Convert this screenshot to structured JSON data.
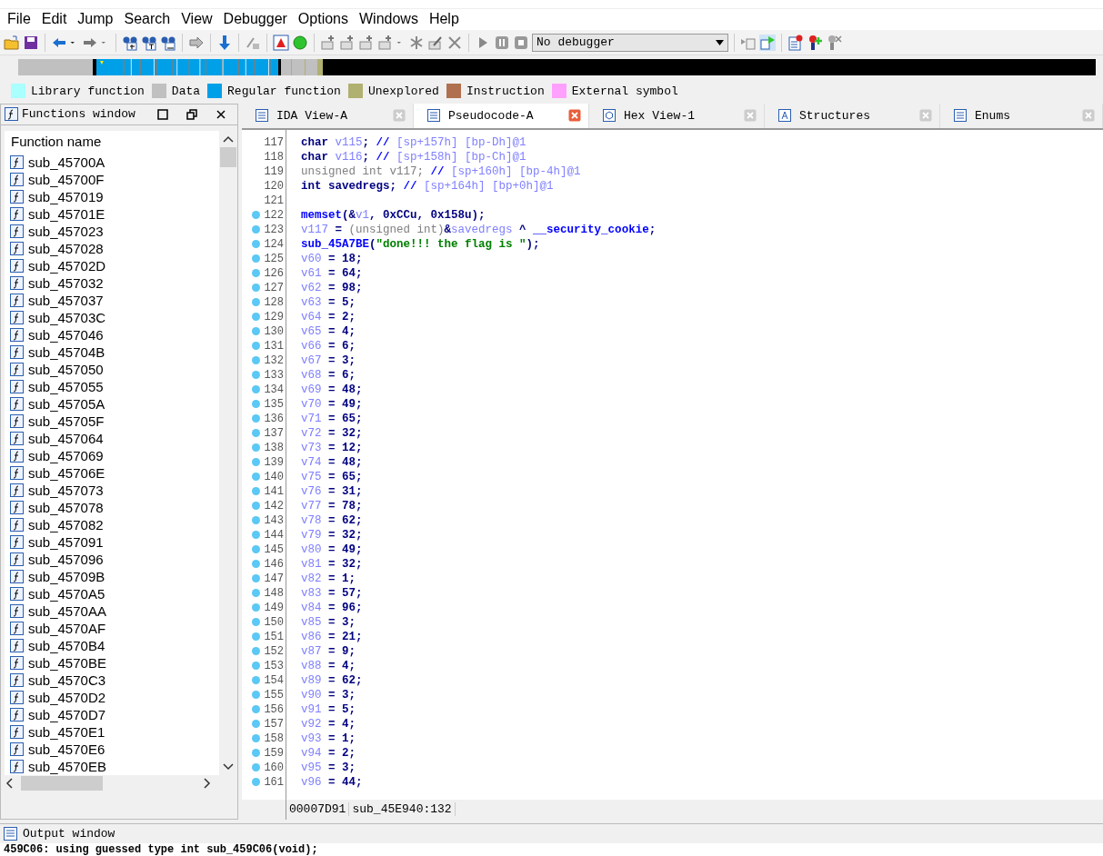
{
  "menu": [
    "File",
    "Edit",
    "Jump",
    "Search",
    "View",
    "Debugger",
    "Options",
    "Windows",
    "Help"
  ],
  "toolbar": {
    "debugger_select": "No debugger"
  },
  "legend": [
    {
      "label": "Library function",
      "color": "#aaffff"
    },
    {
      "label": "Data",
      "color": "#c0c0c0"
    },
    {
      "label": "Regular function",
      "color": "#00a0e8"
    },
    {
      "label": "Unexplored",
      "color": "#b0b070"
    },
    {
      "label": "Instruction",
      "color": "#b07050"
    },
    {
      "label": "External symbol",
      "color": "#ffa0ff"
    }
  ],
  "functions_window": {
    "title": "Functions window",
    "column": "Function name",
    "items": [
      "sub_45700A",
      "sub_45700F",
      "sub_457019",
      "sub_45701E",
      "sub_457023",
      "sub_457028",
      "sub_45702D",
      "sub_457032",
      "sub_457037",
      "sub_45703C",
      "sub_457046",
      "sub_45704B",
      "sub_457050",
      "sub_457055",
      "sub_45705A",
      "sub_45705F",
      "sub_457064",
      "sub_457069",
      "sub_45706E",
      "sub_457073",
      "sub_457078",
      "sub_457082",
      "sub_457091",
      "sub_457096",
      "sub_45709B",
      "sub_4570A5",
      "sub_4570AA",
      "sub_4570AF",
      "sub_4570B4",
      "sub_4570BE",
      "sub_4570C3",
      "sub_4570D2",
      "sub_4570D7",
      "sub_4570E1",
      "sub_4570E6",
      "sub_4570EB"
    ]
  },
  "tabs": [
    {
      "label": "IDA View-A",
      "kind": "listing",
      "selected": false
    },
    {
      "label": "Pseudocode-A",
      "kind": "listing",
      "selected": true
    },
    {
      "label": "Hex View-1",
      "kind": "hex",
      "selected": false
    },
    {
      "label": "Structures",
      "kind": "struct",
      "selected": false
    },
    {
      "label": "Enums",
      "kind": "listing",
      "selected": false
    }
  ],
  "code": [
    {
      "line": "117",
      "breakpoint": false,
      "parts": [
        {
          "text": "char",
          "kind": "keyword"
        },
        {
          "text": " v115",
          "kind": "variable"
        },
        {
          "text": "; ",
          "kind": "plain"
        },
        {
          "text": "// ",
          "kind": "slash"
        },
        {
          "text": "[sp+157h] [bp-Dh]@1",
          "kind": "comment"
        }
      ]
    },
    {
      "line": "118",
      "breakpoint": false,
      "parts": [
        {
          "text": "char",
          "kind": "keyword"
        },
        {
          "text": " v116",
          "kind": "variable"
        },
        {
          "text": "; ",
          "kind": "plain"
        },
        {
          "text": "// ",
          "kind": "slash"
        },
        {
          "text": "[sp+158h] [bp-Ch]@1",
          "kind": "comment"
        }
      ]
    },
    {
      "line": "119",
      "breakpoint": false,
      "parts": [
        {
          "text": "unsigned int v117; ",
          "kind": "unused"
        },
        {
          "text": "// ",
          "kind": "slash"
        },
        {
          "text": "[sp+160h] [bp-4h]@1",
          "kind": "comment"
        }
      ]
    },
    {
      "line": "120",
      "breakpoint": false,
      "parts": [
        {
          "text": "int",
          "kind": "keyword"
        },
        {
          "text": " savedregs; ",
          "kind": "plain"
        },
        {
          "text": "// ",
          "kind": "slash"
        },
        {
          "text": "[sp+164h] [bp+0h]@1",
          "kind": "comment"
        }
      ]
    },
    {
      "line": "121",
      "breakpoint": false
    },
    {
      "line": "122",
      "breakpoint": true,
      "parts": [
        {
          "text": "memset",
          "kind": "function"
        },
        {
          "text": "(&",
          "kind": "plain"
        },
        {
          "text": "v1",
          "kind": "variable"
        },
        {
          "text": ", 0xCCu, 0x158u);",
          "kind": "plain"
        }
      ]
    },
    {
      "line": "123",
      "breakpoint": true,
      "parts": [
        {
          "text": "v117",
          "kind": "variable"
        },
        {
          "text": " = ",
          "kind": "plain"
        },
        {
          "text": "(unsigned int)",
          "kind": "unused"
        },
        {
          "text": "&",
          "kind": "plain"
        },
        {
          "text": "savedregs",
          "kind": "variable"
        },
        {
          "text": " ^ ",
          "kind": "plain"
        },
        {
          "text": "__security_cookie",
          "kind": "function"
        },
        {
          "text": ";",
          "kind": "plain"
        }
      ]
    },
    {
      "line": "124",
      "breakpoint": true,
      "parts": [
        {
          "text": "sub_45A7BE",
          "kind": "function"
        },
        {
          "text": "(",
          "kind": "plain"
        },
        {
          "text": "\"done!!! the flag is \"",
          "kind": "string"
        },
        {
          "text": ");",
          "kind": "plain"
        }
      ]
    },
    {
      "line": "125",
      "breakpoint": true,
      "parts": [
        {
          "text": "v60",
          "kind": "variable"
        },
        {
          "text": " = 18;",
          "kind": "plain"
        }
      ]
    },
    {
      "line": "126",
      "breakpoint": true,
      "parts": [
        {
          "text": "v61",
          "kind": "variable"
        },
        {
          "text": " = 64;",
          "kind": "plain"
        }
      ]
    },
    {
      "line": "127",
      "breakpoint": true,
      "parts": [
        {
          "text": "v62",
          "kind": "variable"
        },
        {
          "text": " = 98;",
          "kind": "plain"
        }
      ]
    },
    {
      "line": "128",
      "breakpoint": true,
      "parts": [
        {
          "text": "v63",
          "kind": "variable"
        },
        {
          "text": " = 5;",
          "kind": "plain"
        }
      ]
    },
    {
      "line": "129",
      "breakpoint": true,
      "parts": [
        {
          "text": "v64",
          "kind": "variable"
        },
        {
          "text": " = 2;",
          "kind": "plain"
        }
      ]
    },
    {
      "line": "130",
      "breakpoint": true,
      "parts": [
        {
          "text": "v65",
          "kind": "variable"
        },
        {
          "text": " = 4;",
          "kind": "plain"
        }
      ]
    },
    {
      "line": "131",
      "breakpoint": true,
      "parts": [
        {
          "text": "v66",
          "kind": "variable"
        },
        {
          "text": " = 6;",
          "kind": "plain"
        }
      ]
    },
    {
      "line": "132",
      "breakpoint": true,
      "parts": [
        {
          "text": "v67",
          "kind": "variable"
        },
        {
          "text": " = 3;",
          "kind": "plain"
        }
      ]
    },
    {
      "line": "133",
      "breakpoint": true,
      "parts": [
        {
          "text": "v68",
          "kind": "variable"
        },
        {
          "text": " = 6;",
          "kind": "plain"
        }
      ]
    },
    {
      "line": "134",
      "breakpoint": true,
      "parts": [
        {
          "text": "v69",
          "kind": "variable"
        },
        {
          "text": " = 48;",
          "kind": "plain"
        }
      ]
    },
    {
      "line": "135",
      "breakpoint": true,
      "parts": [
        {
          "text": "v70",
          "kind": "variable"
        },
        {
          "text": " = 49;",
          "kind": "plain"
        }
      ]
    },
    {
      "line": "136",
      "breakpoint": true,
      "parts": [
        {
          "text": "v71",
          "kind": "variable"
        },
        {
          "text": " = 65;",
          "kind": "plain"
        }
      ]
    },
    {
      "line": "137",
      "breakpoint": true,
      "parts": [
        {
          "text": "v72",
          "kind": "variable"
        },
        {
          "text": " = 32;",
          "kind": "plain"
        }
      ]
    },
    {
      "line": "138",
      "breakpoint": true,
      "parts": [
        {
          "text": "v73",
          "kind": "variable"
        },
        {
          "text": " = 12;",
          "kind": "plain"
        }
      ]
    },
    {
      "line": "139",
      "breakpoint": true,
      "parts": [
        {
          "text": "v74",
          "kind": "variable"
        },
        {
          "text": " = 48;",
          "kind": "plain"
        }
      ]
    },
    {
      "line": "140",
      "breakpoint": true,
      "parts": [
        {
          "text": "v75",
          "kind": "variable"
        },
        {
          "text": " = 65;",
          "kind": "plain"
        }
      ]
    },
    {
      "line": "141",
      "breakpoint": true,
      "parts": [
        {
          "text": "v76",
          "kind": "variable"
        },
        {
          "text": " = 31;",
          "kind": "plain"
        }
      ]
    },
    {
      "line": "142",
      "breakpoint": true,
      "parts": [
        {
          "text": "v77",
          "kind": "variable"
        },
        {
          "text": " = 78;",
          "kind": "plain"
        }
      ]
    },
    {
      "line": "143",
      "breakpoint": true,
      "parts": [
        {
          "text": "v78",
          "kind": "variable"
        },
        {
          "text": " = 62;",
          "kind": "plain"
        }
      ]
    },
    {
      "line": "144",
      "breakpoint": true,
      "parts": [
        {
          "text": "v79",
          "kind": "variable"
        },
        {
          "text": " = 32;",
          "kind": "plain"
        }
      ]
    },
    {
      "line": "145",
      "breakpoint": true,
      "parts": [
        {
          "text": "v80",
          "kind": "variable"
        },
        {
          "text": " = 49;",
          "kind": "plain"
        }
      ]
    },
    {
      "line": "146",
      "breakpoint": true,
      "parts": [
        {
          "text": "v81",
          "kind": "variable"
        },
        {
          "text": " = 32;",
          "kind": "plain"
        }
      ]
    },
    {
      "line": "147",
      "breakpoint": true,
      "parts": [
        {
          "text": "v82",
          "kind": "variable"
        },
        {
          "text": " = 1;",
          "kind": "plain"
        }
      ]
    },
    {
      "line": "148",
      "breakpoint": true,
      "parts": [
        {
          "text": "v83",
          "kind": "variable"
        },
        {
          "text": " = 57;",
          "kind": "plain"
        }
      ]
    },
    {
      "line": "149",
      "breakpoint": true,
      "parts": [
        {
          "text": "v84",
          "kind": "variable"
        },
        {
          "text": " = 96;",
          "kind": "plain"
        }
      ]
    },
    {
      "line": "150",
      "breakpoint": true,
      "parts": [
        {
          "text": "v85",
          "kind": "variable"
        },
        {
          "text": " = 3;",
          "kind": "plain"
        }
      ]
    },
    {
      "line": "151",
      "breakpoint": true,
      "parts": [
        {
          "text": "v86",
          "kind": "variable"
        },
        {
          "text": " = 21;",
          "kind": "plain"
        }
      ]
    },
    {
      "line": "152",
      "breakpoint": true,
      "parts": [
        {
          "text": "v87",
          "kind": "variable"
        },
        {
          "text": " = 9;",
          "kind": "plain"
        }
      ]
    },
    {
      "line": "153",
      "breakpoint": true,
      "parts": [
        {
          "text": "v88",
          "kind": "variable"
        },
        {
          "text": " = 4;",
          "kind": "plain"
        }
      ]
    },
    {
      "line": "154",
      "breakpoint": true,
      "parts": [
        {
          "text": "v89",
          "kind": "variable"
        },
        {
          "text": " = 62;",
          "kind": "plain"
        }
      ]
    },
    {
      "line": "155",
      "breakpoint": true,
      "parts": [
        {
          "text": "v90",
          "kind": "variable"
        },
        {
          "text": " = 3;",
          "kind": "plain"
        }
      ]
    },
    {
      "line": "156",
      "breakpoint": true,
      "parts": [
        {
          "text": "v91",
          "kind": "variable"
        },
        {
          "text": " = 5;",
          "kind": "plain"
        }
      ]
    },
    {
      "line": "157",
      "breakpoint": true,
      "parts": [
        {
          "text": "v92",
          "kind": "variable"
        },
        {
          "text": " = 4;",
          "kind": "plain"
        }
      ]
    },
    {
      "line": "158",
      "breakpoint": true,
      "parts": [
        {
          "text": "v93",
          "kind": "variable"
        },
        {
          "text": " = 1;",
          "kind": "plain"
        }
      ]
    },
    {
      "line": "159",
      "breakpoint": true,
      "parts": [
        {
          "text": "v94",
          "kind": "variable"
        },
        {
          "text": " = 2;",
          "kind": "plain"
        }
      ]
    },
    {
      "line": "160",
      "breakpoint": true,
      "parts": [
        {
          "text": "v95",
          "kind": "variable"
        },
        {
          "text": " = 3;",
          "kind": "plain"
        }
      ]
    },
    {
      "line": "161",
      "breakpoint": true,
      "parts": [
        {
          "text": "v96",
          "kind": "variable"
        },
        {
          "text": " = 44;",
          "kind": "plain"
        }
      ]
    }
  ],
  "status_bar": {
    "address": "00007D91",
    "location": "sub_45E940:132"
  },
  "output_window": {
    "title": "Output window",
    "lines": [
      "459C06: using guessed type int sub_459C06(void);"
    ]
  }
}
